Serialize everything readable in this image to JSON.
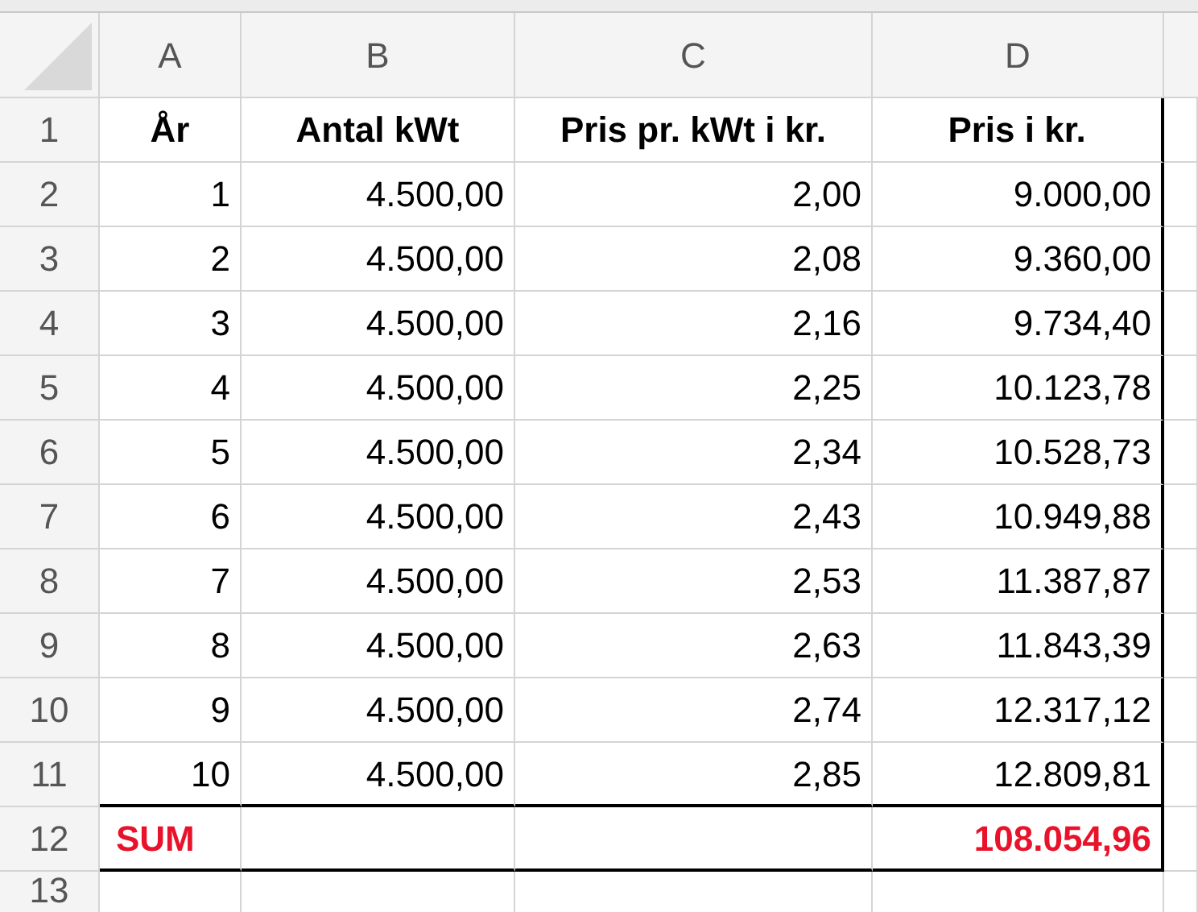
{
  "columns": [
    "A",
    "B",
    "C",
    "D"
  ],
  "rows": [
    {
      "number": "1",
      "kind": "header",
      "cells": [
        "År",
        "Antal kWt",
        "Pris pr. kWt i kr.",
        "Pris i kr."
      ]
    },
    {
      "number": "2",
      "kind": "data",
      "cells": [
        "1",
        "4.500,00",
        "2,00",
        "9.000,00"
      ]
    },
    {
      "number": "3",
      "kind": "data",
      "cells": [
        "2",
        "4.500,00",
        "2,08",
        "9.360,00"
      ]
    },
    {
      "number": "4",
      "kind": "data",
      "cells": [
        "3",
        "4.500,00",
        "2,16",
        "9.734,40"
      ]
    },
    {
      "number": "5",
      "kind": "data",
      "cells": [
        "4",
        "4.500,00",
        "2,25",
        "10.123,78"
      ]
    },
    {
      "number": "6",
      "kind": "data",
      "cells": [
        "5",
        "4.500,00",
        "2,34",
        "10.528,73"
      ]
    },
    {
      "number": "7",
      "kind": "data",
      "cells": [
        "6",
        "4.500,00",
        "2,43",
        "10.949,88"
      ]
    },
    {
      "number": "8",
      "kind": "data",
      "cells": [
        "7",
        "4.500,00",
        "2,53",
        "11.387,87"
      ]
    },
    {
      "number": "9",
      "kind": "data",
      "cells": [
        "8",
        "4.500,00",
        "2,63",
        "11.843,39"
      ]
    },
    {
      "number": "10",
      "kind": "data",
      "cells": [
        "9",
        "4.500,00",
        "2,74",
        "12.317,12"
      ]
    },
    {
      "number": "11",
      "kind": "data",
      "cells": [
        "10",
        "4.500,00",
        "2,85",
        "12.809,81"
      ]
    },
    {
      "number": "12",
      "kind": "sum",
      "label": "SUM",
      "total": "108.054,96"
    },
    {
      "number": "13",
      "kind": "empty"
    }
  ]
}
